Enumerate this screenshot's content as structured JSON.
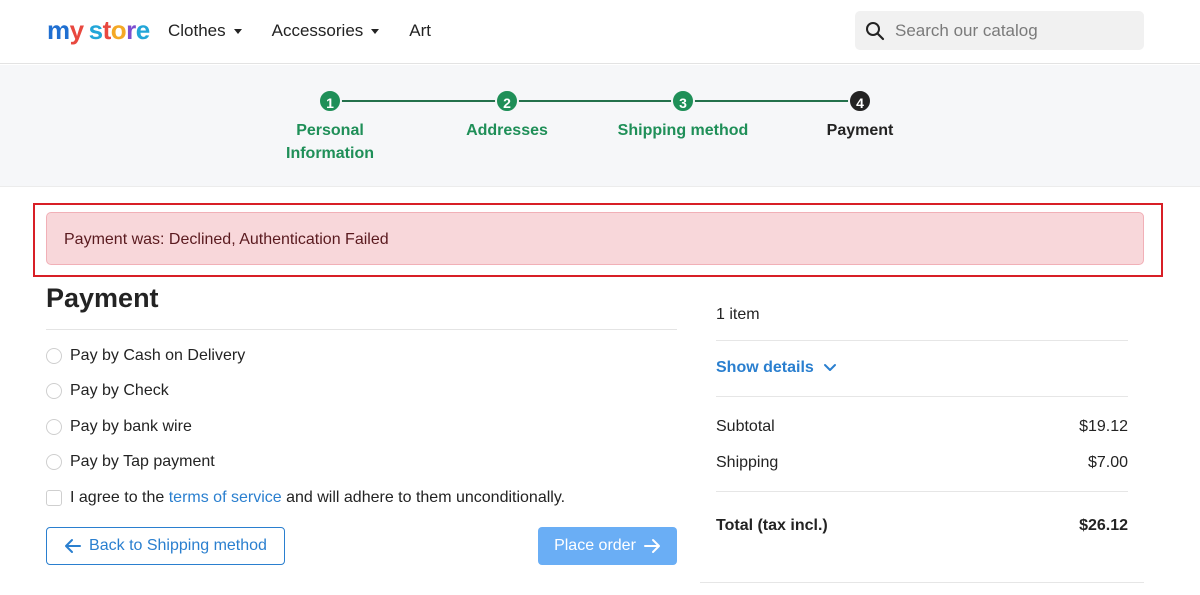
{
  "header": {
    "logo": {
      "letters": [
        "m",
        "y",
        " ",
        "s",
        "t",
        "o",
        "r",
        "e"
      ],
      "colors": [
        "#1f6fd1",
        "#e8483f",
        "#ffffff",
        "#22a6d8",
        "#e8483f",
        "#f4a825",
        "#7c4dcf",
        "#22a6d8"
      ]
    },
    "nav": [
      {
        "label": "Clothes",
        "has_dropdown": true
      },
      {
        "label": "Accessories",
        "has_dropdown": true
      },
      {
        "label": "Art",
        "has_dropdown": false
      }
    ],
    "search": {
      "placeholder": "Search our catalog",
      "value": ""
    }
  },
  "steps": [
    {
      "number": "1",
      "label_line1": "Personal",
      "label_line2": "Information",
      "status": "done"
    },
    {
      "number": "2",
      "label_line1": "Addresses",
      "label_line2": "",
      "status": "done"
    },
    {
      "number": "3",
      "label_line1": "Shipping method",
      "label_line2": "",
      "status": "done"
    },
    {
      "number": "4",
      "label_line1": "Payment",
      "label_line2": "",
      "status": "current"
    }
  ],
  "alert": {
    "message": "Payment was: Declined, Authentication Failed"
  },
  "payment": {
    "title": "Payment",
    "options": [
      {
        "label": "Pay by Cash on Delivery"
      },
      {
        "label": "Pay by Check"
      },
      {
        "label": "Pay by bank wire"
      },
      {
        "label": "Pay by Tap payment"
      }
    ],
    "terms": {
      "prefix": "I agree to the ",
      "link": "terms of service",
      "suffix": " and will adhere to them unconditionally."
    },
    "back_button": "Back to Shipping method",
    "place_order_button": "Place order"
  },
  "summary": {
    "items_count": "1 item",
    "show_details": "Show details",
    "subtotal_label": "Subtotal",
    "subtotal_value": "$19.12",
    "shipping_label": "Shipping",
    "shipping_value": "$7.00",
    "total_label": "Total (tax incl.)",
    "total_value": "$26.12"
  },
  "colors": {
    "accent_green": "#1f8f58",
    "link_blue": "#2a7fcf",
    "alert_bg": "#f8d7da",
    "highlight_red": "#d81f26"
  }
}
